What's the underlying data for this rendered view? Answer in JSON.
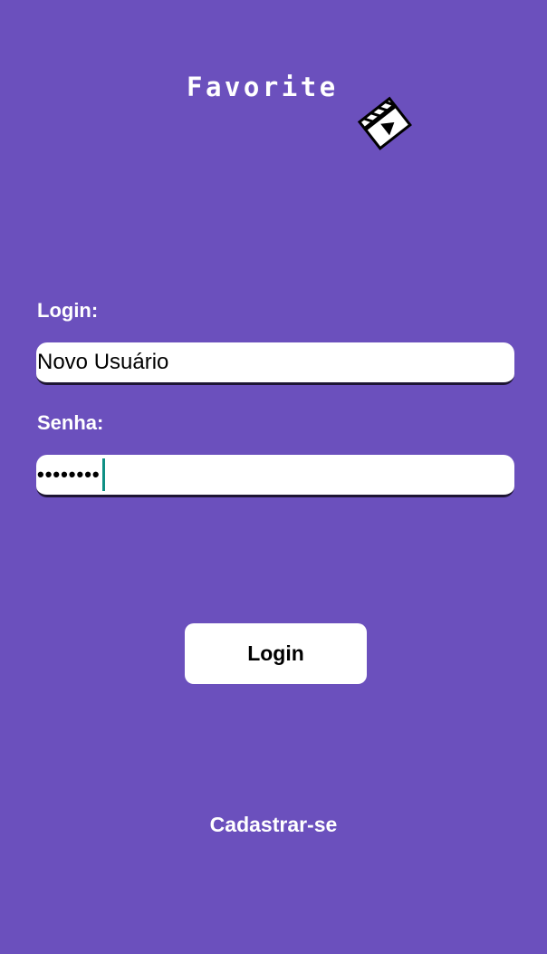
{
  "app": {
    "title": "Favorite",
    "logo_icon": "film-clapperboard-icon"
  },
  "form": {
    "login_label": "Login:",
    "login_value": "Novo Usuário",
    "password_label": "Senha:",
    "password_value": "••••••••",
    "submit_label": "Login",
    "signup_label": "Cadastrar-se"
  },
  "colors": {
    "background": "#6b50bd",
    "field_background": "#ffffff",
    "cursor": "#0e8f84",
    "text_on_background": "#ffffff"
  }
}
